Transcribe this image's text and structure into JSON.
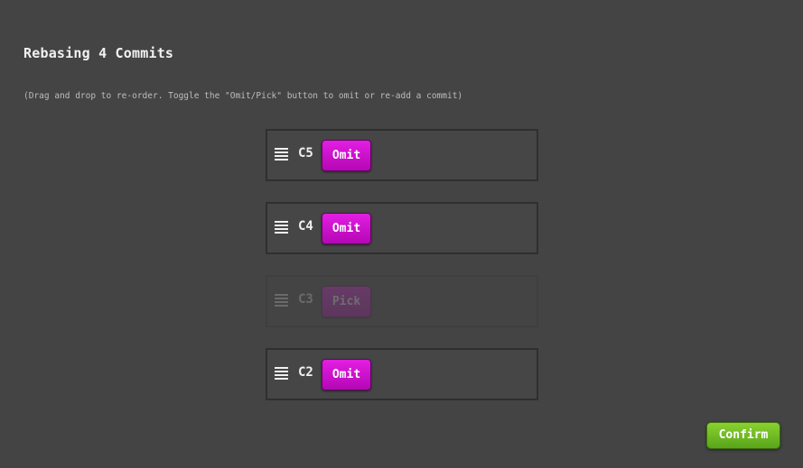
{
  "dialog": {
    "title": "Rebasing 4 Commits",
    "instructions": "(Drag and drop to re-order. Toggle the \"Omit/Pick\" button to omit or re-add a commit)"
  },
  "commits": [
    {
      "id": "C5",
      "toggle_label": "Omit",
      "state": "pick"
    },
    {
      "id": "C4",
      "toggle_label": "Omit",
      "state": "pick"
    },
    {
      "id": "C3",
      "toggle_label": "Pick",
      "state": "omit"
    },
    {
      "id": "C2",
      "toggle_label": "Omit",
      "state": "pick"
    }
  ],
  "confirm_label": "Confirm",
  "icons": {
    "drag_handle": "drag-handle-icon"
  },
  "colors": {
    "background": "#444444",
    "omit_pick_button": "#d212d2",
    "confirm_button": "#72bd25"
  }
}
